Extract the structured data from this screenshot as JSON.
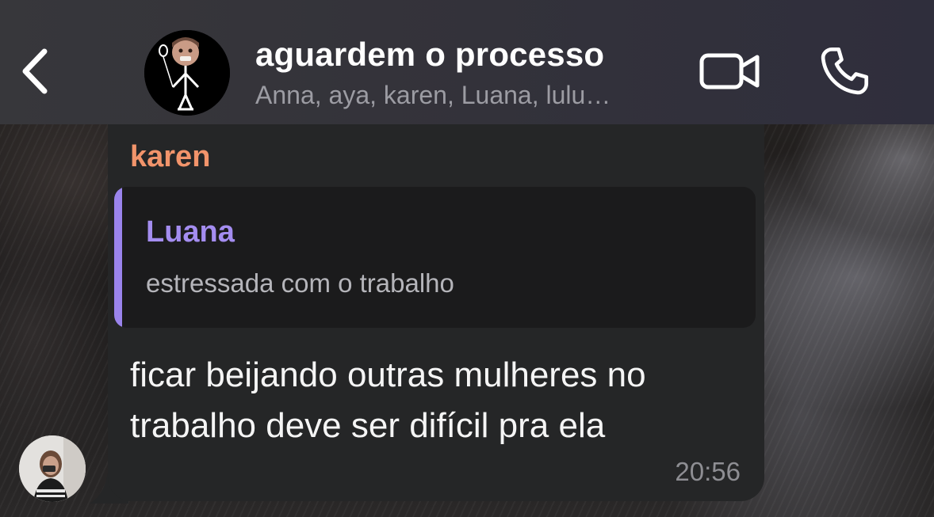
{
  "header": {
    "title": "aguardem o processo",
    "members": "Anna, aya, karen, Luana, lulu…",
    "back_icon": "chevron-left-icon",
    "video_icon": "video-camera-icon",
    "call_icon": "phone-icon"
  },
  "message": {
    "sender": "karen",
    "sender_color": "#f2946b",
    "reply": {
      "author": "Luana",
      "author_color": "#a48df0",
      "text": "estressada com o trabalho"
    },
    "text": "ficar beijando outras mulheres no trabalho deve ser difícil pra ela",
    "time": "20:56"
  }
}
